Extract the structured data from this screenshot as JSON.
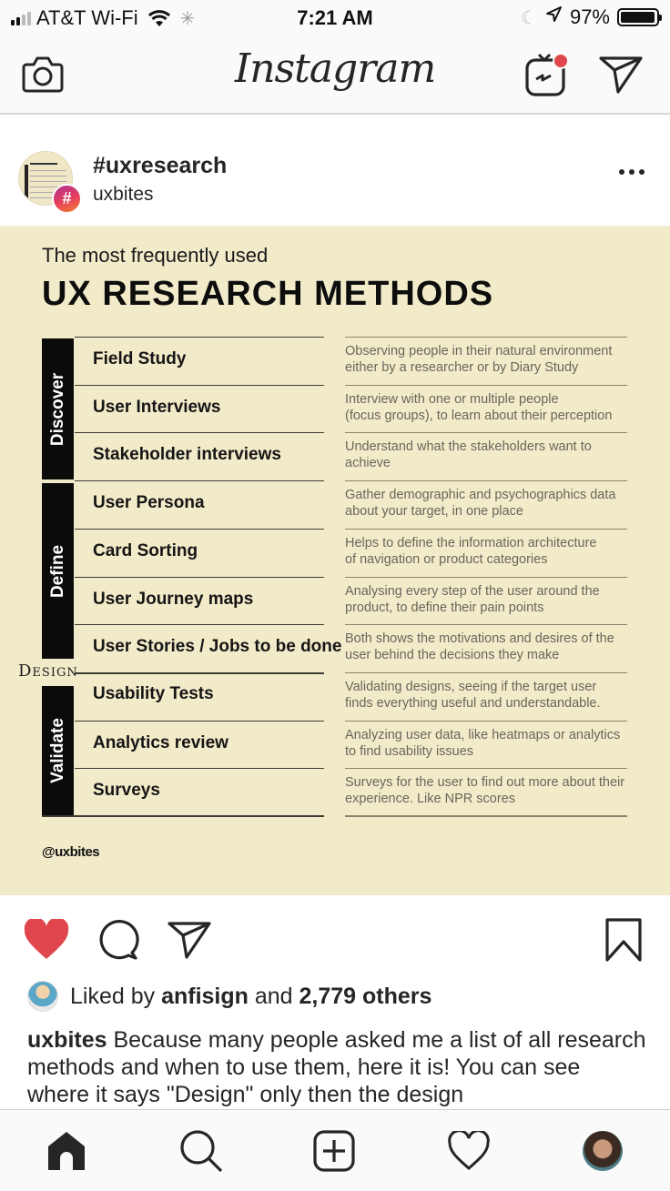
{
  "status_bar": {
    "carrier": "AT&T Wi-Fi",
    "time": "7:21 AM",
    "battery": "97%",
    "battery_level": 0.97,
    "icons": [
      "signal-icon",
      "wifi-icon",
      "activity-spinner-icon",
      "do-not-disturb-moon-icon",
      "location-arrow-icon",
      "battery-icon"
    ]
  },
  "top_nav": {
    "logo": "Instagram",
    "icons": [
      "camera-icon",
      "igtv-icon",
      "direct-message-icon"
    ],
    "igtv_badge_color": "#e0474c"
  },
  "post": {
    "title": "#uxresearch",
    "subtitle": "uxbites",
    "badge_glyph": "#"
  },
  "infographic": {
    "background": "#f2ebca",
    "subtitle": "The most frequently used",
    "title": "UX RESEARCH METHODS",
    "phases": [
      {
        "label": "Discover"
      },
      {
        "label": "Define"
      },
      {
        "label": "Validate"
      }
    ],
    "design_label": "Design",
    "methods": [
      {
        "phase": "Discover",
        "name": "Field Study",
        "description": "Observing people in their natural environment\neither by a researcher or by Diary Study"
      },
      {
        "phase": "Discover",
        "name": "User Interviews",
        "description": "Interview with one or multiple people\n(focus groups), to learn about their perception"
      },
      {
        "phase": "Discover",
        "name": "Stakeholder interviews",
        "description": "Understand what the stakeholders want to\nachieve"
      },
      {
        "phase": "Define",
        "name": "User Persona",
        "description": "Gather demographic and psychographics data\nabout your target, in one place"
      },
      {
        "phase": "Define",
        "name": "Card Sorting",
        "description": "Helps to define the information architecture\nof navigation or product categories"
      },
      {
        "phase": "Define",
        "name": "User Journey maps",
        "description": "Analysing every step of the user around the\nproduct, to define their pain points"
      },
      {
        "phase": "Define",
        "name": "User Stories / Jobs to be done",
        "description": "Both shows the motivations and desires of the\nuser behind the decisions they make"
      },
      {
        "phase": "Validate",
        "name": "Usability Tests",
        "description": "Validating designs, seeing if the target user\nfinds everything useful and understandable."
      },
      {
        "phase": "Validate",
        "name": "Analytics review",
        "description": "Analyzing user data, like heatmaps or analytics\nto find usability issues"
      },
      {
        "phase": "Validate",
        "name": "Surveys",
        "description": "Surveys for the user to find out more about their\nexperience. Like NPR scores"
      }
    ],
    "handle": "@uxbites"
  },
  "actions": {
    "liked": true,
    "like_color": "#e0474c",
    "icons": [
      "heart-filled-icon",
      "comment-icon",
      "share-icon",
      "bookmark-icon"
    ]
  },
  "likes": {
    "prefix": "Liked by ",
    "user": "anfisign",
    "middle": " and ",
    "count": "2,779 others"
  },
  "caption": {
    "user": "uxbites",
    "text": " Because many people asked me a list of all research methods and when to use them, here it is! You can see where it says \"Design\" only then the design"
  },
  "tab_bar": {
    "tabs": [
      "home",
      "search",
      "new-post",
      "activity",
      "profile"
    ],
    "active": "home"
  }
}
